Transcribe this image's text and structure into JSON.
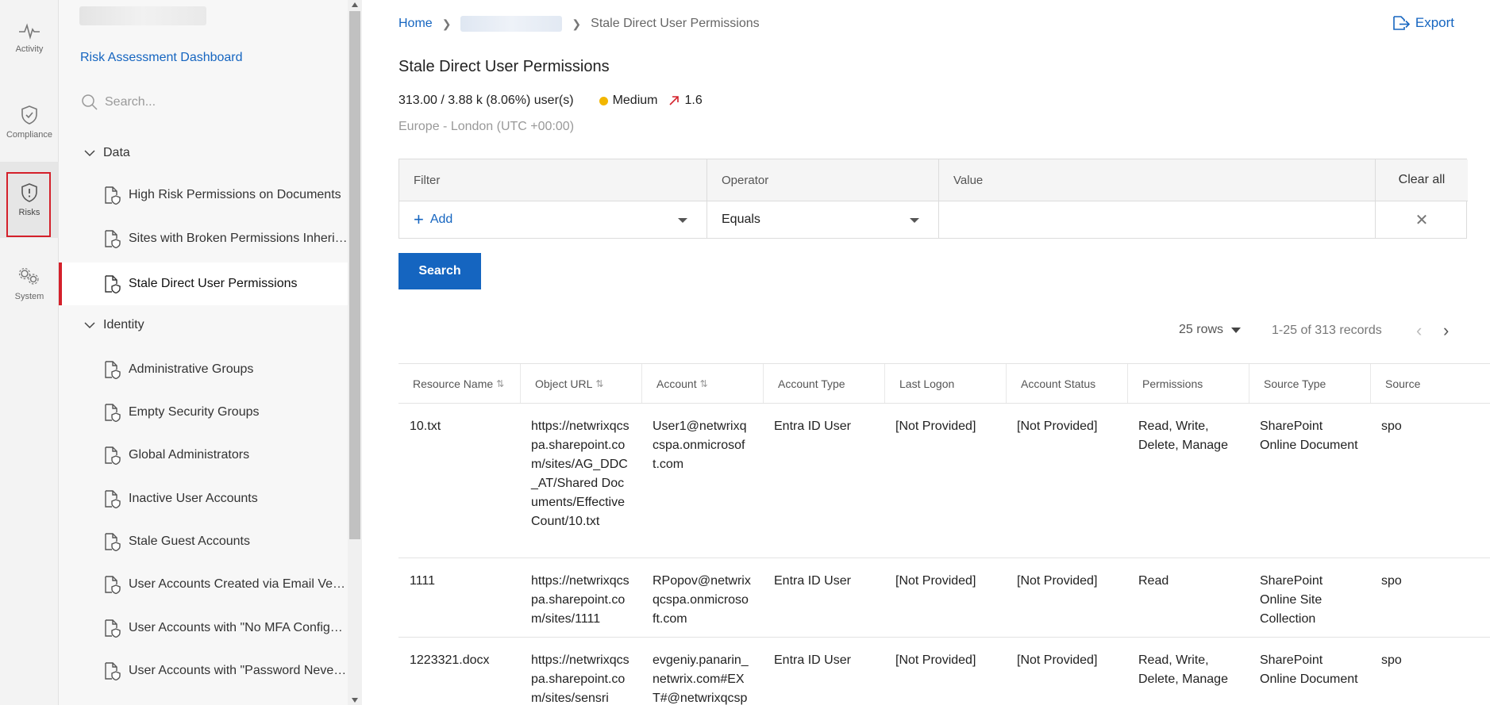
{
  "rail": {
    "items": [
      {
        "label": "Activity",
        "icon": "activity-icon"
      },
      {
        "label": "Compliance",
        "icon": "shield-check-icon"
      },
      {
        "label": "Risks",
        "icon": "shield-alert-icon"
      },
      {
        "label": "System",
        "icon": "gears-icon"
      }
    ]
  },
  "sidebar": {
    "dashboard_link": "Risk Assessment Dashboard",
    "search_placeholder": "Search...",
    "sections": [
      {
        "label": "Data",
        "items": [
          {
            "label": "High Risk Permissions on Documents"
          },
          {
            "label": "Sites with Broken Permissions Inheritance"
          },
          {
            "label": "Stale Direct User Permissions"
          }
        ]
      },
      {
        "label": "Identity",
        "items": [
          {
            "label": "Administrative Groups"
          },
          {
            "label": "Empty Security Groups"
          },
          {
            "label": "Global Administrators"
          },
          {
            "label": "Inactive User Accounts"
          },
          {
            "label": "Stale Guest Accounts"
          },
          {
            "label": "User Accounts Created via Email Verification"
          },
          {
            "label": "User Accounts with \"No MFA Configured\""
          },
          {
            "label": "User Accounts with \"Password Never Expires\""
          }
        ]
      }
    ]
  },
  "breadcrumb": {
    "home": "Home",
    "current": "Stale Direct User Permissions"
  },
  "header": {
    "export_label": "Export",
    "title": "Stale Direct User Permissions",
    "summary_count": "313.00 / 3.88 k (8.06%) user(s)",
    "risk_level": "Medium",
    "risk_color": "#f2b600",
    "trend_value": "1.6",
    "timezone": "Europe - London (UTC +00:00)"
  },
  "filter": {
    "col_filter": "Filter",
    "col_operator": "Operator",
    "col_value": "Value",
    "clear_all": "Clear all",
    "add_label": "Add",
    "operator_value": "Equals",
    "value_value": ""
  },
  "search_label": "Search",
  "pagination": {
    "rows_label": "25 rows",
    "records_label": "1-25 of 313 records"
  },
  "table": {
    "columns": [
      "Resource Name",
      "Object URL",
      "Account",
      "Account Type",
      "Last Logon",
      "Account Status",
      "Permissions",
      "Source Type",
      "Source"
    ],
    "rows": [
      [
        "10.txt",
        "https://netwrixqcspa.sharepoint.com/sites/AG_DDC_AT/Shared Documents/EffectiveCount/10.txt",
        "User1@netwrixqcspa.onmicrosoft.com",
        "Entra ID User",
        "[Not Provided]",
        "[Not Provided]",
        "Read, Write, Delete, Manage",
        "SharePoint Online Document",
        "spo"
      ],
      [
        "1111",
        "https://netwrixqcspa.sharepoint.com/sites/1111",
        "RPopov@netwrixqcspa.onmicrosoft.com",
        "Entra ID User",
        "[Not Provided]",
        "[Not Provided]",
        "Read",
        "SharePoint Online Site Collection",
        "spo"
      ],
      [
        "1223321.docx",
        "https://netwrixqcspa.sharepoint.com/sites/sensri",
        "evgeniy.panarin_netwrix.com#EXT#@netwrixqcsp",
        "Entra ID User",
        "[Not Provided]",
        "[Not Provided]",
        "Read, Write, Delete, Manage",
        "SharePoint Online Document",
        "spo"
      ]
    ]
  }
}
